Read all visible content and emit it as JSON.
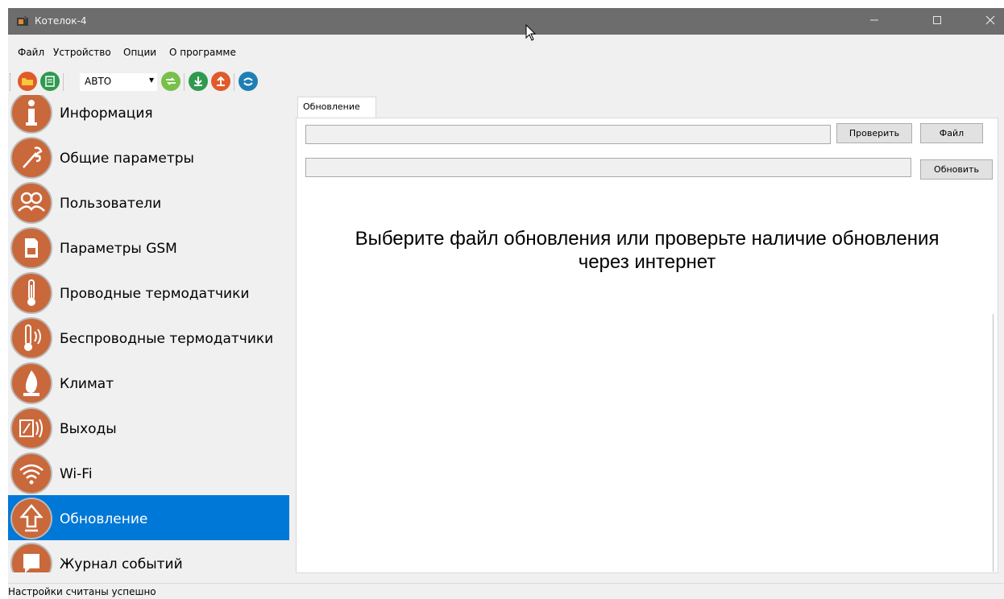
{
  "window": {
    "title": "Котелок-4",
    "minimize_icon": "minimize-icon",
    "maximize_icon": "maximize-icon",
    "close_icon": "close-icon"
  },
  "menu": {
    "items": [
      "Файл",
      "Устройство",
      "Опции",
      "О программе"
    ]
  },
  "toolbar": {
    "combo_value": "АВТО",
    "icons": [
      "open-folder-icon",
      "save-icon",
      "connect-icon",
      "download-icon",
      "upload-icon",
      "sync-icon"
    ]
  },
  "sidebar": {
    "items": [
      {
        "label": "Информация",
        "icon": "info-icon"
      },
      {
        "label": "Общие параметры",
        "icon": "wrench-icon"
      },
      {
        "label": "Пользователи",
        "icon": "users-icon"
      },
      {
        "label": "Параметры GSM",
        "icon": "sim-card-icon"
      },
      {
        "label": "Проводные термодатчики",
        "icon": "thermometer-icon"
      },
      {
        "label": "Беспроводные термодатчики",
        "icon": "wireless-thermometer-icon"
      },
      {
        "label": "Климат",
        "icon": "flame-icon"
      },
      {
        "label": "Выходы",
        "icon": "outputs-icon"
      },
      {
        "label": "Wi-Fi",
        "icon": "wifi-icon"
      },
      {
        "label": "Обновление",
        "icon": "update-arrow-icon"
      },
      {
        "label": "Журнал событий",
        "icon": "event-log-icon"
      }
    ],
    "selected": "Обновление"
  },
  "content": {
    "tab_label": "Обновление",
    "check_button": "Проверить",
    "file_button": "Файл",
    "update_button": "Обновить",
    "message_line1": "Выберите файл обновления или проверьте наличие обновления",
    "message_line2": "через интернет"
  },
  "status": {
    "text": "Настройки считаны успешно"
  },
  "colors": {
    "accent": "#0078d7",
    "icon_circle": "#c9683b",
    "titlebar": "#6d6d6d"
  }
}
